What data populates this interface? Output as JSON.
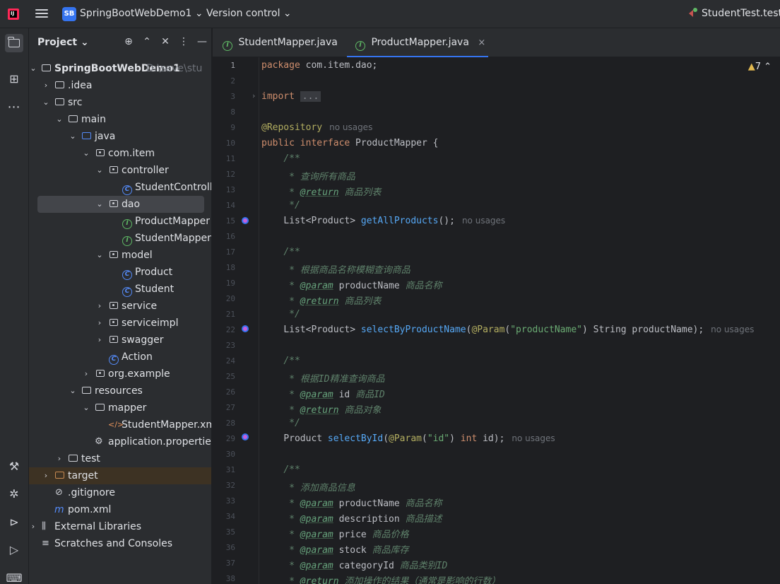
{
  "titlebar": {
    "project_name": "SpringBootWebDemo1 ⌄",
    "project_badge": "SB",
    "version_control": "Version control ⌄",
    "run_config": "StudentTest.testT"
  },
  "project_panel": {
    "title": "Project ⌄",
    "tree": {
      "root_label": "SpringBootWebDemo1",
      "root_path": "D:\\save\\stu",
      "idea": ".idea",
      "src": "src",
      "main": "main",
      "java": "java",
      "com_item": "com.item",
      "controller": "controller",
      "student_controller": "StudentController",
      "dao": "dao",
      "product_mapper": "ProductMapper",
      "student_mapper": "StudentMapper",
      "model": "model",
      "product": "Product",
      "student": "Student",
      "service": "service",
      "serviceimpl": "serviceimpl",
      "swagger": "swagger",
      "action": "Action",
      "org_example": "org.example",
      "resources": "resources",
      "mapper": "mapper",
      "student_mapper_xml": "StudentMapper.xml",
      "app_properties": "application.properties",
      "test": "test",
      "target": "target",
      "gitignore": ".gitignore",
      "pom": "pom.xml",
      "external_libraries": "External Libraries",
      "scratches": "Scratches and Consoles"
    }
  },
  "tabs": [
    {
      "label": "StudentMapper.java"
    },
    {
      "label": "ProductMapper.java"
    }
  ],
  "editor": {
    "warning_count": "7",
    "no_usages": "no usages",
    "line_numbers": [
      "1",
      "2",
      "3",
      "8",
      "9",
      "10",
      "11",
      "12",
      "13",
      "14",
      "15",
      "16",
      "17",
      "18",
      "19",
      "20",
      "21",
      "22",
      "23",
      "24",
      "25",
      "26",
      "27",
      "28",
      "29",
      "30",
      "31",
      "32",
      "33",
      "34",
      "35",
      "36",
      "37",
      "38"
    ],
    "pkg_kw": "package",
    "pkg_name": " com.item.dao;",
    "import_kw": "import",
    "import_folded": "...",
    "repository": "@Repository",
    "iface_decl_kw": "public interface",
    "iface_name": " ProductMapper {",
    "doc_open": "/**",
    "doc_close": "*/",
    "c1_desc": " * 查询所有商品",
    "tag_return": "@return",
    "tag_param": "@param",
    "c1_return": " 商品列表",
    "m1_type": "List<Product>",
    "m1_name": " getAllProducts",
    "m1_tail": "();",
    "c2_desc": " * 根据商品名称模糊查询商品",
    "c2_param_name": " productName",
    "c2_param_desc": " 商品名称",
    "c2_return": " 商品列表",
    "m2_name": " selectByProductName",
    "m2_open": "(",
    "m2_ann": "@Param",
    "m2_str": "\"productName\"",
    "m2_tail": ") String productName);",
    "c3_desc": " * 根据ID精准查询商品",
    "c3_param_name": " id",
    "c3_param_desc": " 商品ID",
    "c3_return": " 商品对象",
    "m3_type": "Product",
    "m3_name": " selectById",
    "m3_str": "\"id\"",
    "m3_kw": "int",
    "m3_tail": " id);",
    "c4_desc": " * 添加商品信息",
    "c4_p1": " productName",
    "c4_p1d": " 商品名称",
    "c4_p2": " description",
    "c4_p2d": " 商品描述",
    "c4_p3": " price",
    "c4_p3d": " 商品价格",
    "c4_p4": " stock",
    "c4_p4d": " 商品库存",
    "c4_p5": " categoryId",
    "c4_p5d": " 商品类别ID",
    "c4_return": " 添加操作的结果（通常是影响的行数）"
  }
}
